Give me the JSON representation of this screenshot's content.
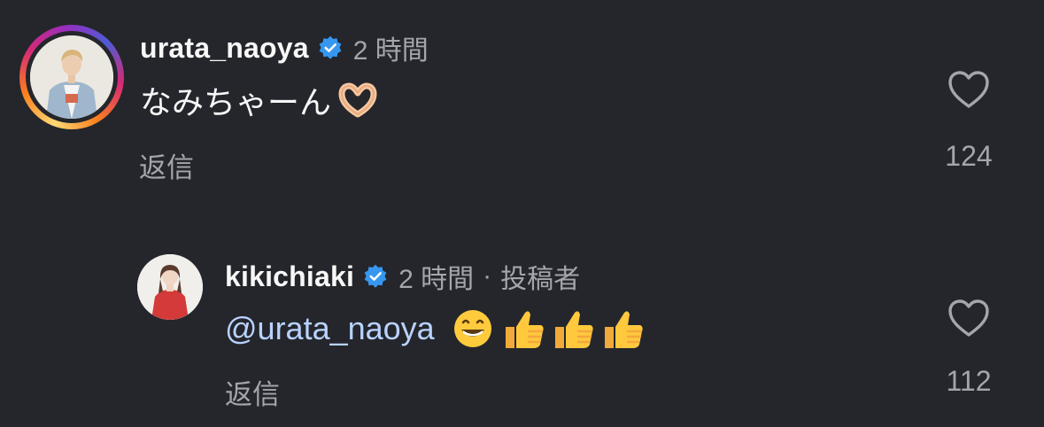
{
  "comments": [
    {
      "username": "urata_naoya",
      "time": "2 時間",
      "text": "なみちゃーん",
      "emoji": "heart-hands",
      "reply_label": "返信",
      "like_count": "124"
    },
    {
      "username": "kikichiaki",
      "time": "2 時間",
      "separator": "·",
      "author_label": "投稿者",
      "mention": "@urata_naoya",
      "emojis": [
        "grinning-face",
        "thumbs-up",
        "thumbs-up",
        "thumbs-up"
      ],
      "reply_label": "返信",
      "like_count": "112"
    }
  ],
  "colors": {
    "background": "#24262b",
    "muted_text": "#a3a6ad",
    "mention": "#b9d2ff",
    "verified_badge": "#3797f0"
  }
}
